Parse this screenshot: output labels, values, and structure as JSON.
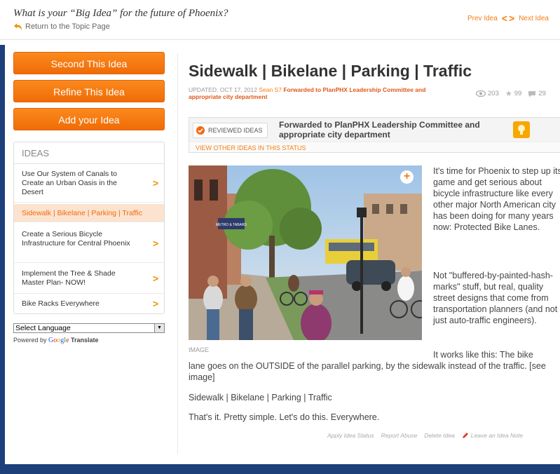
{
  "header": {
    "topic_title": "What is your “Big Idea” for the future of Phoenix?",
    "return_link": "Return to the Topic Page",
    "prev_idea": "Prev Idea",
    "next_idea": "Next Idea"
  },
  "sidebar": {
    "buttons": [
      {
        "label": "Second This Idea"
      },
      {
        "label": "Refine This Idea"
      },
      {
        "label": "Add your Idea"
      }
    ],
    "ideas_header": "IDEAS",
    "ideas": [
      {
        "label": "Use Our System of Canals to Create an Urban Oasis in the Desert"
      },
      {
        "label": "Sidewalk | Bikelane | Parking | Traffic",
        "active": true
      },
      {
        "label": "Create a Serious Bicycle Infrastructure for Central Phoenix"
      },
      {
        "label": "Implement the Tree & Shade Master Plan- NOW!"
      },
      {
        "label": "Bike Racks Everywhere"
      }
    ],
    "language_select": "Select Language",
    "powered_by": "Powered by",
    "google_letters": [
      "G",
      "o",
      "o",
      "g",
      "l",
      "e"
    ],
    "translate": "Translate"
  },
  "idea": {
    "title": "Sidewalk | Bikelane | Parking | Traffic",
    "updated": "UPDATED: OCT 17, 2012",
    "author": "Sean S7",
    "forwarded": "Forwarded to PlanPHX Leadership Committee and appropriate city department",
    "stats": {
      "views": "203",
      "stars": "99",
      "comments": "29"
    },
    "status_badge": "REVIEWED IDEAS",
    "status_text": "Forwarded to PlanPHX Leadership Committee and appropriate city department",
    "view_other": "VIEW OTHER IDEAS IN THIS STATUS",
    "image_caption": "IMAGE",
    "image_sign": "METRO & TABARD",
    "p1": "It's time for Phoenix to step up its game and get serious about bicycle infrastructure like every other major North American city has been doing for many years now: Protected Bike Lanes.",
    "p2": "Not \"buffered-by-painted-hash-marks\" stuff, but real, quality street designs that come from transportation planners (and not just auto-traffic engineers).",
    "p3a": "It works like this: The bike",
    "p3b": "lane goes on the OUTSIDE of the parallel parking, by the sidewalk instead of the traffic. [see image]",
    "p4": "Sidewalk | Bikelane | Parking | Traffic",
    "p5": "That's it. Pretty simple. Let's do this. Everywhere.",
    "actions": {
      "apply_status": "Apply Idea Status",
      "report_abuse": "Report Abuse",
      "delete_idea": "Delete Idea",
      "leave_note": "Leave an Idea Note"
    }
  },
  "colors": {
    "accent": "#f47e12",
    "frame": "#1d3f7a"
  }
}
